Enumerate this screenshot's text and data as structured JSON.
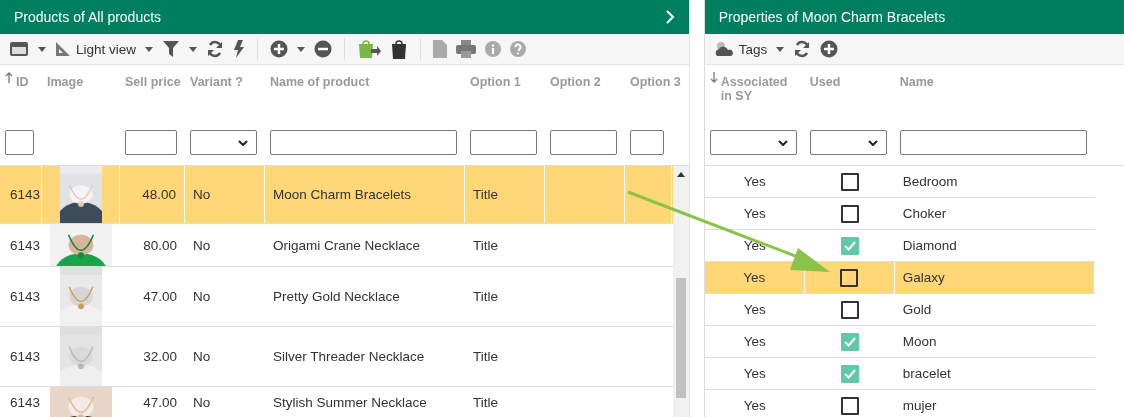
{
  "products_panel": {
    "title": "Products of All products",
    "toolbar": {
      "view_label": "Light view"
    },
    "columns": [
      {
        "label": "ID",
        "sorted_ascending": true,
        "sorted_descending": false,
        "filter": {
          "kind": "text"
        }
      },
      {
        "label": "Image",
        "sorted_ascending": false,
        "sorted_descending": false
      },
      {
        "label": "Sell price",
        "sorted_ascending": false,
        "sorted_descending": false,
        "filter": {
          "kind": "text"
        }
      },
      {
        "label": "Variant ?",
        "sorted_ascending": false,
        "sorted_descending": false,
        "filter": {
          "kind": "select"
        }
      },
      {
        "label": "Name of product",
        "sorted_ascending": false,
        "sorted_descending": false,
        "filter": {
          "kind": "text"
        }
      },
      {
        "label": "Option 1",
        "sorted_ascending": false,
        "sorted_descending": false,
        "filter": {
          "kind": "text"
        }
      },
      {
        "label": "Option 2",
        "sorted_ascending": false,
        "sorted_descending": false,
        "filter": {
          "kind": "text"
        }
      },
      {
        "label": "Option 3",
        "sorted_ascending": false,
        "sorted_descending": false,
        "filter": {
          "kind": "text"
        }
      }
    ],
    "rows": [
      {
        "id": "6143",
        "price": "48.00",
        "variant": "No",
        "name": "Moon Charm Bracelets",
        "option_1": "Title",
        "selected": true
      },
      {
        "id": "6143",
        "price": "80.00",
        "variant": "No",
        "name": "Origami Crane Necklace",
        "option_1": "Title",
        "selected": false
      },
      {
        "id": "6143",
        "price": "47.00",
        "variant": "No",
        "name": "Pretty Gold Necklace",
        "option_1": "Title",
        "selected": false
      },
      {
        "id": "6143",
        "price": "32.00",
        "variant": "No",
        "name": "Silver Threader Necklace",
        "option_1": "Title",
        "selected": false
      },
      {
        "id": "6143",
        "price": "47.00",
        "variant": "No",
        "name": "Stylish Summer Necklace",
        "option_1": "Title",
        "selected": false
      }
    ]
  },
  "properties_panel": {
    "title": "Properties of Moon Charm Bracelets",
    "toolbar": {
      "label": "Tags"
    },
    "columns": [
      {
        "label": "Associated in SY",
        "sorted_ascending": false,
        "sorted_descending": true,
        "filter": {
          "kind": "select"
        }
      },
      {
        "label": "Used",
        "sorted_ascending": false,
        "sorted_descending": false,
        "filter": {
          "kind": "select"
        }
      },
      {
        "label": "Name",
        "sorted_ascending": false,
        "sorted_descending": false,
        "filter": {
          "kind": "text"
        }
      }
    ],
    "rows": [
      {
        "associated": "Yes",
        "used": false,
        "name": "Bedroom",
        "selected": false
      },
      {
        "associated": "Yes",
        "used": false,
        "name": "Choker",
        "selected": false
      },
      {
        "associated": "Yes",
        "used": true,
        "name": "Diamond",
        "selected": false
      },
      {
        "associated": "Yes",
        "used": false,
        "name": "Galaxy",
        "selected": true
      },
      {
        "associated": "Yes",
        "used": false,
        "name": "Gold",
        "selected": false
      },
      {
        "associated": "Yes",
        "used": true,
        "name": "Moon",
        "selected": false
      },
      {
        "associated": "Yes",
        "used": true,
        "name": "bracelet",
        "selected": false
      },
      {
        "associated": "Yes",
        "used": false,
        "name": "mujer",
        "selected": false
      }
    ]
  }
}
